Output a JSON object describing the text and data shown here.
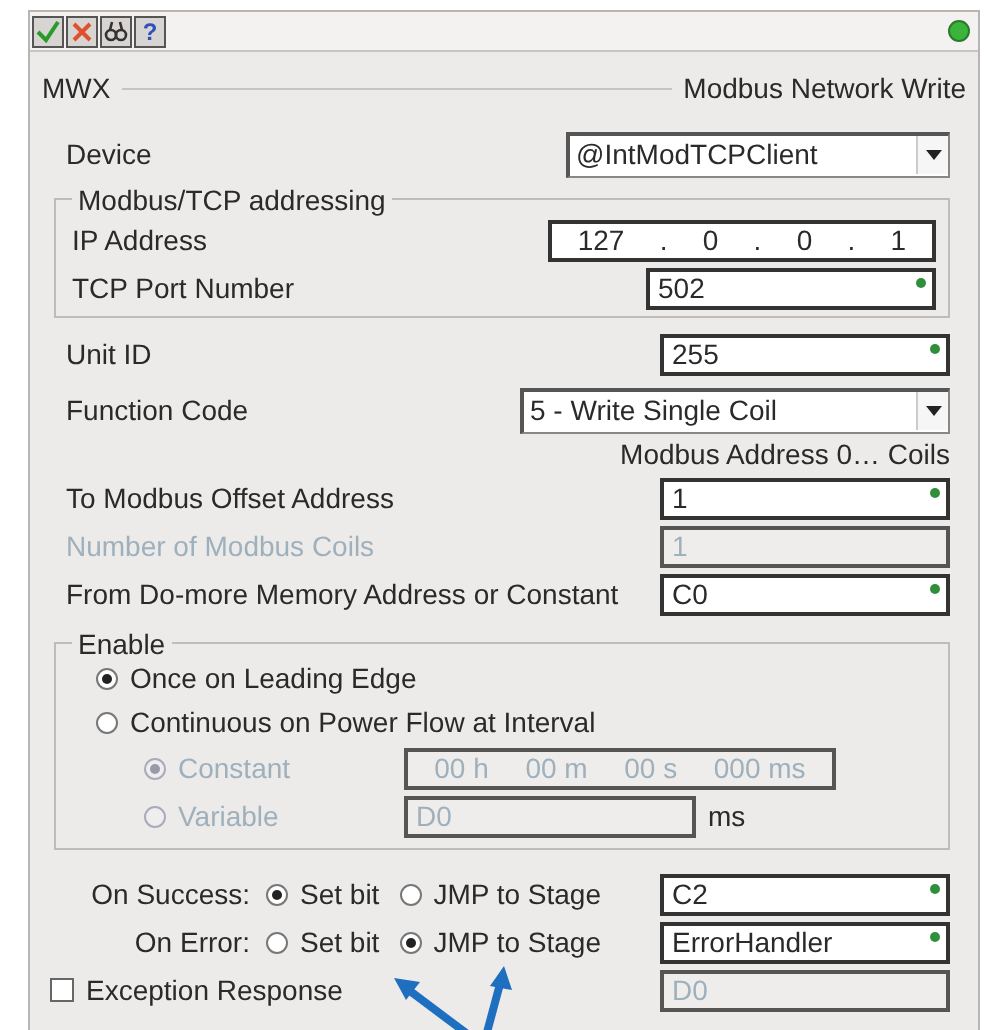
{
  "toolbar": {
    "buttons": [
      {
        "kind": "ok"
      },
      {
        "kind": "cancel"
      },
      {
        "kind": "find"
      },
      {
        "kind": "help",
        "label": "?"
      }
    ]
  },
  "header": {
    "code": "MWX",
    "title": "Modbus Network Write"
  },
  "device": {
    "label": "Device",
    "value": "@IntModTCPClient"
  },
  "tcp_group": {
    "title": "Modbus/TCP addressing",
    "ip_label": "IP Address",
    "ip_octets": [
      "127",
      "0",
      "0",
      "1"
    ],
    "ip_separators": [
      ".",
      ".",
      "."
    ],
    "port_label": "TCP Port Number",
    "port_value": "502",
    "port_valid": true
  },
  "unit_id": {
    "label": "Unit ID",
    "value": "255",
    "valid": true
  },
  "function_code": {
    "label": "Function Code",
    "value": "5 - Write Single Coil"
  },
  "address_hint": "Modbus Address 0… Coils",
  "fields": [
    {
      "label": "To Modbus Offset Address",
      "value": "1",
      "valid": true,
      "disabled": false
    },
    {
      "label": "Number of Modbus Coils",
      "value": "1",
      "valid": false,
      "disabled": true
    },
    {
      "label": "From Do-more Memory Address or Constant",
      "value": "C0",
      "valid": true,
      "disabled": false
    }
  ],
  "enable": {
    "title": "Enable",
    "options": [
      {
        "label": "Once on Leading Edge",
        "selected": true
      },
      {
        "label": "Continuous on Power Flow at Interval",
        "selected": false
      }
    ],
    "interval": {
      "disabled": true,
      "constant": {
        "label": "Constant",
        "selected": true,
        "parts": [
          "00 h",
          "00 m",
          "00 s",
          "000 ms"
        ]
      },
      "variable": {
        "label": "Variable",
        "selected": false,
        "value": "D0",
        "unit": "ms"
      }
    }
  },
  "outcomes": [
    {
      "label": "On Success:",
      "options": [
        {
          "label": "Set bit",
          "selected": true
        },
        {
          "label": "JMP to Stage",
          "selected": false
        }
      ],
      "value": "C2",
      "valid": true
    },
    {
      "label": "On Error:",
      "options": [
        {
          "label": "Set bit",
          "selected": false
        },
        {
          "label": "JMP to Stage",
          "selected": true
        }
      ],
      "value": "ErrorHandler",
      "valid": true
    }
  ],
  "exception": {
    "label": "Exception Response",
    "checked": false,
    "value": "D0",
    "disabled": true
  }
}
